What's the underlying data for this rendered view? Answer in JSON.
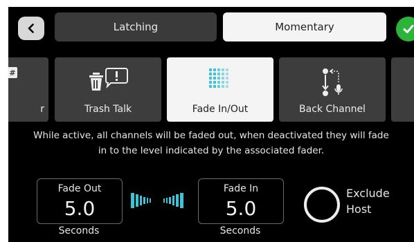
{
  "header": {
    "back_icon": "chevron-left-icon",
    "modes": [
      {
        "label": "Latching",
        "selected": false
      },
      {
        "label": "Momentary",
        "selected": true
      }
    ],
    "confirm_icon": "checkmark-icon"
  },
  "tiles": [
    {
      "label": "r",
      "icon": "hash-icon",
      "partial": true
    },
    {
      "label": "Trash Talk",
      "icon": "trash-speech-icon"
    },
    {
      "label": "Fade In/Out",
      "icon": "dot-grid-icon",
      "selected": true
    },
    {
      "label": "Back Channel",
      "icon": "back-channel-icon"
    },
    {
      "label": "",
      "partial": true
    }
  ],
  "description": "While active, all channels will be faded out, when deactivated they will fade in to the level indicated by the associated fader.",
  "fade_out": {
    "title": "Fade Out",
    "value": "5.0",
    "unit": "Seconds"
  },
  "fade_in": {
    "title": "Fade In",
    "value": "5.0",
    "unit": "Seconds"
  },
  "exclude_host": {
    "label_line1": "Exclude",
    "label_line2": "Host",
    "checked": false
  },
  "colors": {
    "accent": "#3fc3d6",
    "confirm": "#2bb33a",
    "tile": "#3d3d3d",
    "selected": "#f4f4f4"
  }
}
